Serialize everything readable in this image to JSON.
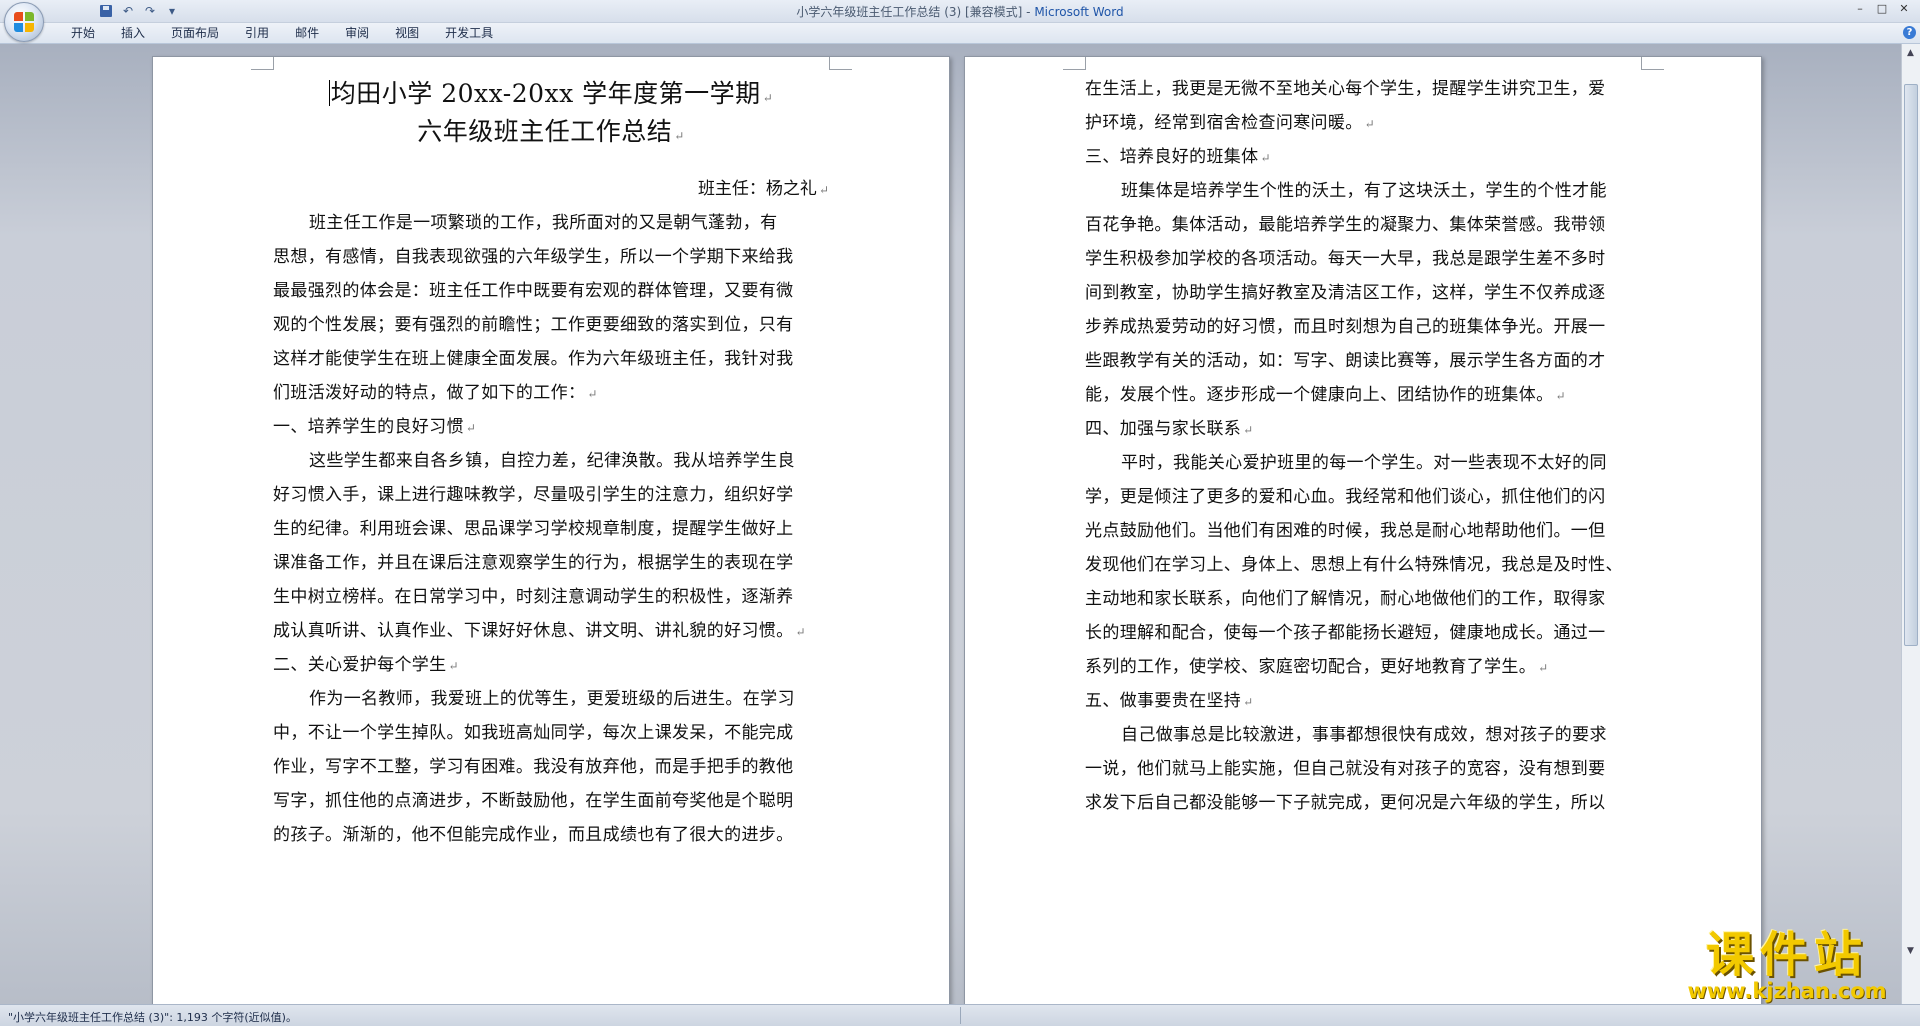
{
  "window": {
    "title_doc": "小学六年级班主任工作总结 (3) [兼容模式] - ",
    "title_app": "Microsoft Word",
    "minimize": "–",
    "restore": "□",
    "close": "✕"
  },
  "qat": {
    "undo": "↶",
    "redo": "↷",
    "dropdown": "▾",
    "sep": "|"
  },
  "ribbon": {
    "tabs": [
      "开始",
      "插入",
      "页面布局",
      "引用",
      "邮件",
      "审阅",
      "视图",
      "开发工具"
    ],
    "help": "?"
  },
  "page1": {
    "title_line1": "均田小学 20xx-20xx 学年度第一学期",
    "title_line2": "六年级班主任工作总结",
    "signature": "班主任：杨之礼",
    "lines": [
      "班主任工作是一项繁琐的工作，我所面对的又是朝气蓬勃，有",
      "思想，有感情，自我表现欲强的六年级学生，所以一个学期下来给我",
      "最最强烈的体会是：班主任工作中既要有宏观的群体管理，又要有微",
      "观的个性发展；要有强烈的前瞻性；工作更要细致的落实到位，只有",
      "这样才能使学生在班上健康全面发展。作为六年级班主任，我针对我",
      "们班活泼好动的特点，做了如下的工作：",
      "一、培养学生的良好习惯",
      "这些学生都来自各乡镇，自控力差，纪律涣散。我从培养学生良",
      "好习惯入手，课上进行趣味教学，尽量吸引学生的注意力，组织好学",
      "生的纪律。利用班会课、思品课学习学校规章制度，提醒学生做好上",
      "课准备工作，并且在课后注意观察学生的行为，根据学生的表现在学",
      "生中树立榜样。在日常学习中，时刻注意调动学生的积极性，逐渐养",
      "成认真听讲、认真作业、下课好好休息、讲文明、讲礼貌的好习惯。",
      "二、关心爱护每个学生",
      "作为一名教师，我爱班上的优等生，更爱班级的后进生。在学习",
      "中，不让一个学生掉队。如我班高灿同学，每次上课发呆，不能完成",
      "作业，写字不工整，学习有困难。我没有放弃他，而是手把手的教他",
      "写字，抓住他的点滴进步，不断鼓励他，在学生面前夸奖他是个聪明",
      "的孩子。渐渐的，他不但能完成作业，而且成绩也有了很大的进步。"
    ]
  },
  "page2": {
    "lines": [
      "在生活上，我更是无微不至地关心每个学生，提醒学生讲究卫生，爱",
      "护环境，经常到宿舍检查问寒问暖。",
      "三、培养良好的班集体",
      "班集体是培养学生个性的沃土，有了这块沃土，学生的个性才能",
      "百花争艳。集体活动，最能培养学生的凝聚力、集体荣誉感。我带领",
      "学生积极参加学校的各项活动。每天一大早，我总是跟学生差不多时",
      "间到教室，协助学生搞好教室及清洁区工作，这样，学生不仅养成逐",
      "步养成热爱劳动的好习惯，而且时刻想为自己的班集体争光。开展一",
      "些跟教学有关的活动，如：写字、朗读比赛等，展示学生各方面的才",
      "能，发展个性。逐步形成一个健康向上、团结协作的班集体。",
      "四、加强与家长联系",
      "平时，我能关心爱护班里的每一个学生。对一些表现不太好的同",
      "学，更是倾注了更多的爱和心血。我经常和他们谈心，抓住他们的闪",
      "光点鼓励他们。当他们有困难的时候，我总是耐心地帮助他们。一但",
      "发现他们在学习上、身体上、思想上有什么特殊情况，我总是及时性、",
      "主动地和家长联系，向他们了解情况，耐心地做他们的工作，取得家",
      "长的理解和配合，使每一个孩子都能扬长避短，健康地成长。通过一",
      "系列的工作，使学校、家庭密切配合，更好地教育了学生。",
      "五、做事要贵在坚持",
      "自己做事总是比较激进，事事都想很快有成效，想对孩子的要求",
      "一说，他们就马上能实施，但自己就没有对孩子的宽容，没有想到要",
      "求发下后自己都没能够一下子就完成，更何况是六年级的学生，所以"
    ]
  },
  "paragraph_mark": "↵",
  "status": {
    "text": "\"小学六年级班主任工作总结 (3)\": 1,193 个字符(近似值)。"
  },
  "scrollbar": {
    "up": "▲",
    "down": "▼"
  },
  "watermark": {
    "name": "课件站",
    "url": "www.kjzhan.com"
  },
  "colors": {
    "accent": "#1f55a8",
    "watermark": "#f2c900"
  }
}
